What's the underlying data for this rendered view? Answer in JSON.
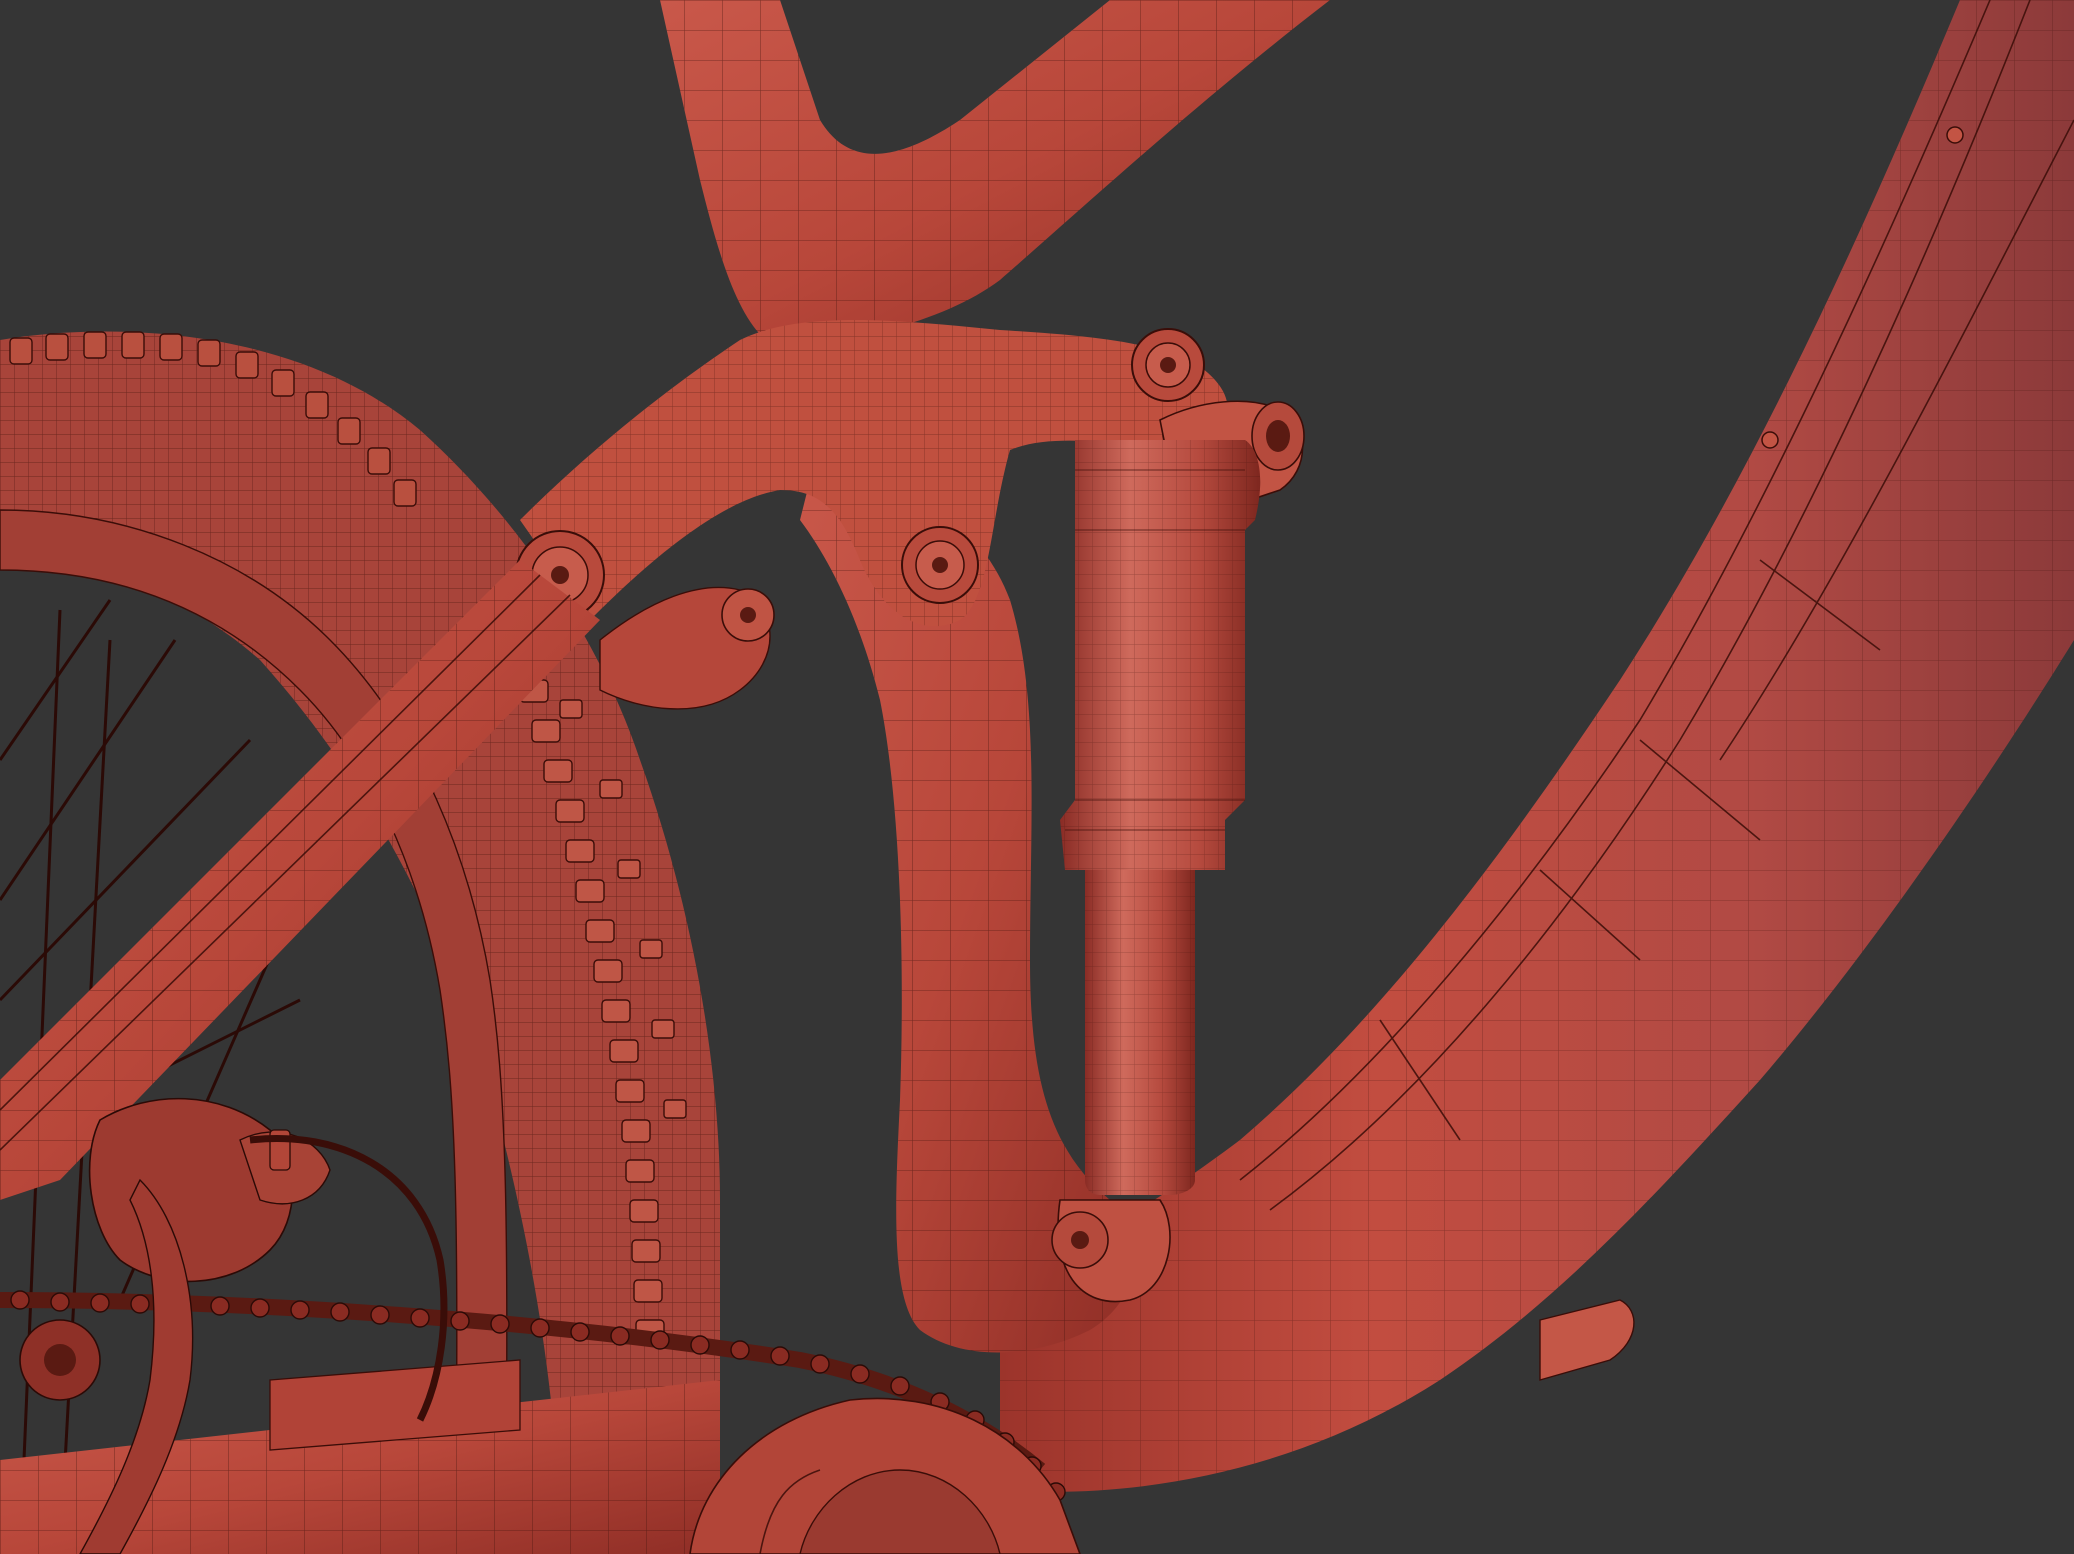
{
  "scene": {
    "subject": "wireframe-bicycle-rear-suspension",
    "colors": {
      "background": "#353535",
      "frame_light": "#c8574a",
      "frame_mid": "#b5453a",
      "frame_dark": "#8e2f27",
      "wire": "#3a0d08",
      "tire": "#a9443a"
    }
  }
}
